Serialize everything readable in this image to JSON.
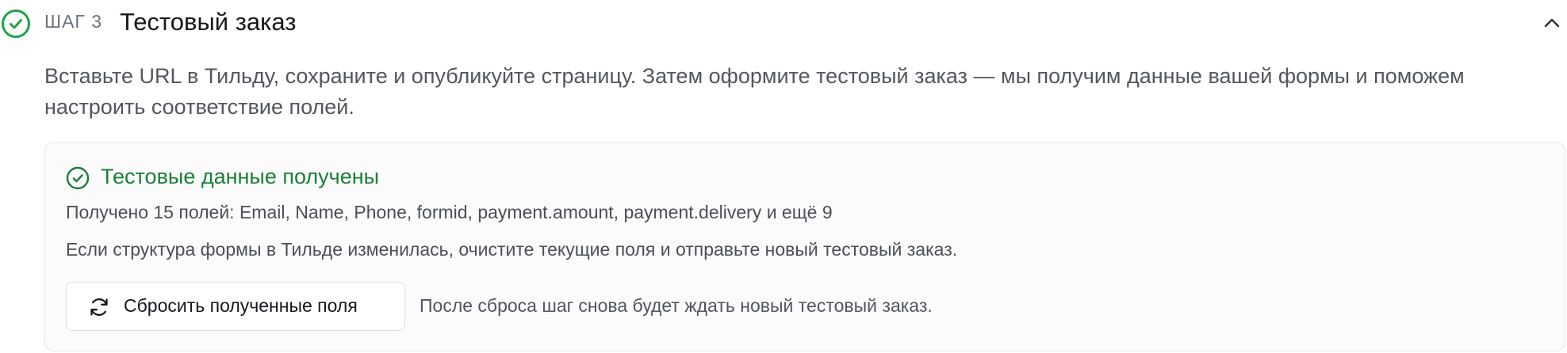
{
  "step": {
    "number_label": "ШАГ 3",
    "title": "Тестовый заказ",
    "description": "Вставьте URL в Тильду, сохраните и опубликуйте страницу. Затем оформите тестовый заказ — мы получим данные вашей формы и поможем настроить соответствие полей.",
    "status": "completed",
    "expanded": true
  },
  "result": {
    "title": "Тестовые данные получены",
    "fields_summary": "Получено 15 полей: Email, Name, Phone, formid, payment.amount, payment.delivery и ещё 9",
    "hint": "Если структура формы в Тильде изменилась, очистите текущие поля и отправьте новый тестовый заказ.",
    "reset_button_label": "Сбросить полученные поля",
    "reset_note": "После сброса шаг снова будет ждать новый тестовый заказ."
  },
  "icons": {
    "step_status": "check-circle-icon",
    "collapse": "chevron-up-icon",
    "success": "check-circle-icon",
    "reset": "refresh-icon"
  },
  "colors": {
    "success": "#1a7f37",
    "step_check": "#22a04b",
    "text_primary": "#16181d",
    "text_secondary": "#52565e",
    "card_border": "#e6e7ea",
    "card_background": "#fbfbfc"
  }
}
